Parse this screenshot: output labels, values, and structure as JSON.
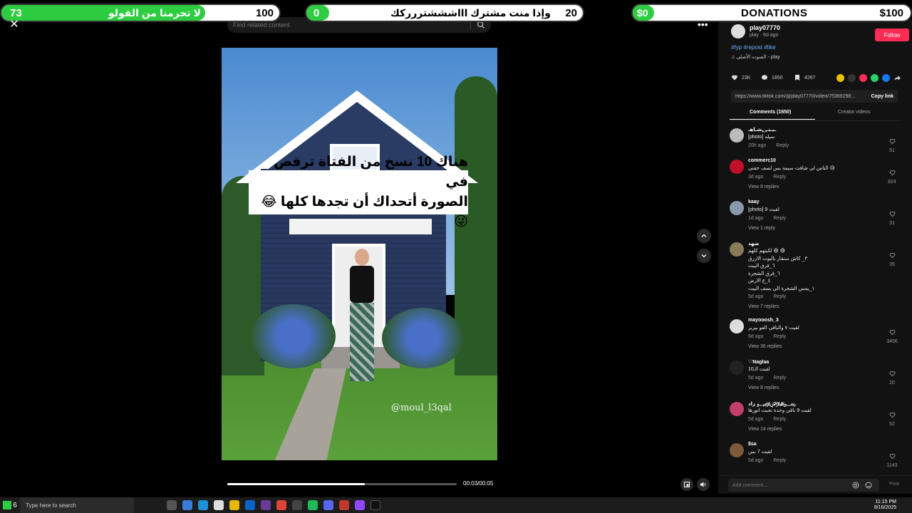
{
  "overlay": {
    "bar1": {
      "left_num": "73",
      "text": "لا تحرمنا من الفولو",
      "right_num": "100",
      "progress": 0.73
    },
    "bar2": {
      "left_num": "0",
      "text": "وإذا منت مشترك اااشششتررركك",
      "right_num": "20",
      "progress": 0.0
    },
    "bar3": {
      "left_num": "$0",
      "text": "DONATIONS",
      "right_num": "$100",
      "progress": 0.0
    }
  },
  "search": {
    "placeholder": "Find related content"
  },
  "video": {
    "caption_line1": "هناك 10 نسخ من الفتاة ترقص في",
    "caption_line2": "الصورة أتحداك أن تجدها كلها 😂😜",
    "watermark": "@moul_l3qal",
    "time": "00:03/00:05",
    "progress": 0.6
  },
  "author": {
    "name": "play07770",
    "meta": "play · 6d ago",
    "follow_label": "Follow",
    "hashtags": "#fyp #repost #like",
    "sound": "♫ الصوت الأصلي - play"
  },
  "stats": {
    "likes": "23K",
    "comments": "1650",
    "saves": "4267"
  },
  "link": {
    "url": "https://www.tiktok.com/@play07770/video/75369298...",
    "copy_label": "Copy link"
  },
  "tabs": {
    "comments": "Comments (1650)",
    "creator": "Creator videos"
  },
  "comments": [
    {
      "user": "ـيـنـﮩ˛ﮩشـاهـ",
      "text": "[photo] سيله",
      "time": "20h ago",
      "reply": "Reply",
      "likes": "51",
      "replies": "",
      "avatar_color": "#bbbbbb"
    },
    {
      "user": "commerc10",
      "text": "الناس لي شافت سيمة يس لصف حفني 😢",
      "time": "3d ago",
      "reply": "Reply",
      "likes": "824",
      "replies": "View 9 replies",
      "avatar_color": "#c0102a"
    },
    {
      "user": "kaay",
      "text": "[photo] لقيت 9",
      "time": "1d ago",
      "reply": "Reply",
      "likes": "31",
      "replies": "View 1 reply",
      "avatar_color": "#8899aa"
    },
    {
      "user": "ضهد",
      "text": "لكيتهم كلهم 😄 😅\n٣_ كاش سنفار باليوت الازرق\n٦_فرق البيت\n٦_فرق الشجرة\n٤_ع الارض\n١_يمس الشجرة الي يسف البيت",
      "time": "5d ago",
      "reply": "Reply",
      "likes": "35",
      "replies": "View 7 replies",
      "avatar_color": "#8a7a5a"
    },
    {
      "user": "mayooosh_3",
      "text": "لقيت ٧ والباقي الغو بيرير",
      "time": "6d ago",
      "reply": "Reply",
      "likes": "3456",
      "replies": "View 36 replies",
      "avatar_color": "#dddddd"
    },
    {
      "user": "♡Naglaa",
      "text": "لقيت الـ10",
      "time": "5d ago",
      "reply": "Reply",
      "likes": "20",
      "replies": "View 8 replies",
      "avatar_color": "#222222"
    },
    {
      "user": "زاد ﷽.",
      "text": "لقيت 9 باقي وحدة تحبث انورها",
      "time": "5d ago",
      "reply": "Reply",
      "likes": "52",
      "replies": "View 14 replies",
      "avatar_color": "#c0406a"
    },
    {
      "user": "$sa",
      "text": "لقيت 7 بس",
      "time": "5d ago",
      "reply": "Reply",
      "likes": "1143",
      "replies": "",
      "avatar_color": "#7a5a3a"
    }
  ],
  "comment_bar": {
    "placeholder": "Add comment...",
    "post_label": "Post"
  },
  "taskbar": {
    "search_placeholder": "Type here to search",
    "badge": "6",
    "time": "11:15 PM",
    "date": "8/16/2025"
  },
  "colors": {
    "accent": "#fe2c55",
    "progress_green": "#2ecc40",
    "panel_bg": "#121212"
  }
}
